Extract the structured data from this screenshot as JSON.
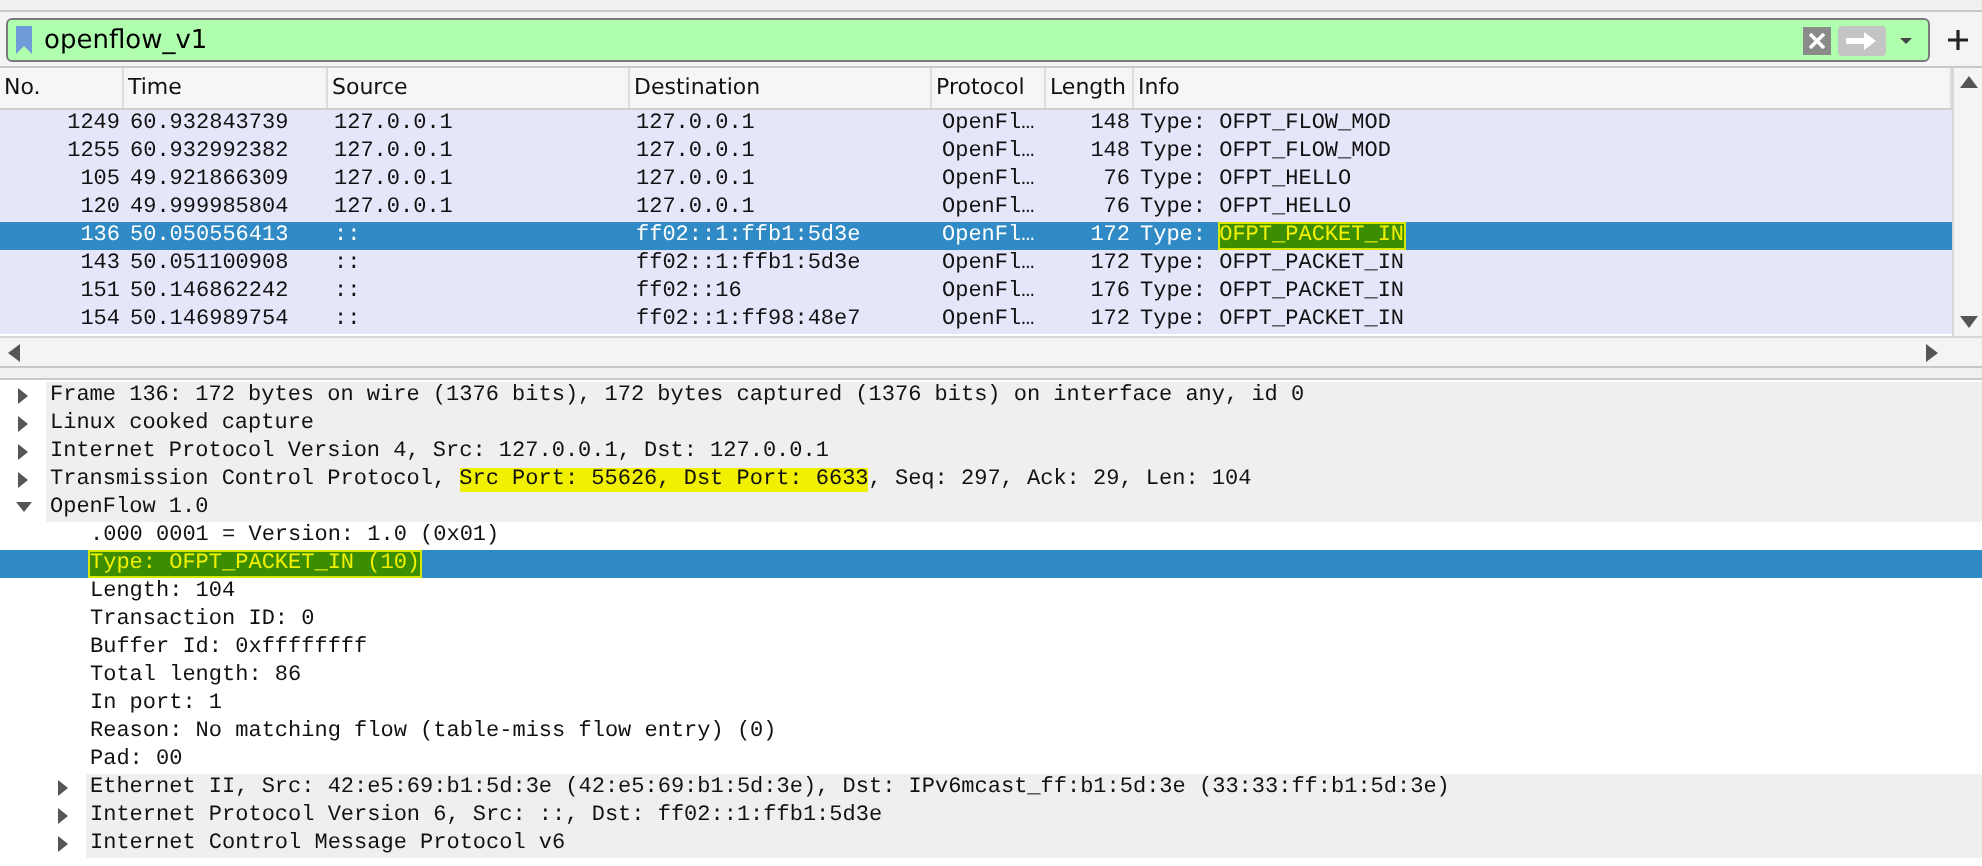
{
  "filter": {
    "value": "openflow_v1"
  },
  "packet_list": {
    "columns": [
      "No.",
      "Time",
      "Source",
      "Destination",
      "Protocol",
      "Length",
      "Info"
    ],
    "rows": [
      {
        "no": "1249",
        "time": "60.932843739",
        "source": "127.0.0.1",
        "destination": "127.0.0.1",
        "protocol": "OpenFl…",
        "length": "148",
        "info": [
          {
            "text": "Type: ",
            "highlighted": false
          },
          {
            "text": "OFPT_FLOW_MOD",
            "highlighted": false
          }
        ],
        "selected": false
      },
      {
        "no": "1255",
        "time": "60.932992382",
        "source": "127.0.0.1",
        "destination": "127.0.0.1",
        "protocol": "OpenFl…",
        "length": "148",
        "info": [
          {
            "text": "Type: ",
            "highlighted": false
          },
          {
            "text": "OFPT_FLOW_MOD",
            "highlighted": false
          }
        ],
        "selected": false
      },
      {
        "no": "105",
        "time": "49.921866309",
        "source": "127.0.0.1",
        "destination": "127.0.0.1",
        "protocol": "OpenFl…",
        "length": "76",
        "info": [
          {
            "text": "Type: ",
            "highlighted": false
          },
          {
            "text": "OFPT_HELLO",
            "highlighted": false
          }
        ],
        "selected": false
      },
      {
        "no": "120",
        "time": "49.999985804",
        "source": "127.0.0.1",
        "destination": "127.0.0.1",
        "protocol": "OpenFl…",
        "length": "76",
        "info": [
          {
            "text": "Type: ",
            "highlighted": false
          },
          {
            "text": "OFPT_HELLO",
            "highlighted": false
          }
        ],
        "selected": false
      },
      {
        "no": "136",
        "time": "50.050556413",
        "source": "::",
        "destination": "ff02::1:ffb1:5d3e",
        "protocol": "OpenFl…",
        "length": "172",
        "info": [
          {
            "text": "Type: ",
            "highlighted": false
          },
          {
            "text": "OFPT_PACKET_IN",
            "highlighted": true
          }
        ],
        "selected": true
      },
      {
        "no": "143",
        "time": "50.051100908",
        "source": "::",
        "destination": "ff02::1:ffb1:5d3e",
        "protocol": "OpenFl…",
        "length": "172",
        "info": [
          {
            "text": "Type: ",
            "highlighted": false
          },
          {
            "text": "OFPT_PACKET_IN",
            "highlighted": false
          }
        ],
        "selected": false
      },
      {
        "no": "151",
        "time": "50.146862242",
        "source": "::",
        "destination": "ff02::16",
        "protocol": "OpenFl…",
        "length": "176",
        "info": [
          {
            "text": "Type: ",
            "highlighted": false
          },
          {
            "text": "OFPT_PACKET_IN",
            "highlighted": false
          }
        ],
        "selected": false
      },
      {
        "no": "154",
        "time": "50.146989754",
        "source": "::",
        "destination": "ff02::1:ff98:48e7",
        "protocol": "OpenFl…",
        "length": "172",
        "info": [
          {
            "text": "Type: ",
            "highlighted": false
          },
          {
            "text": "OFPT_PACKET_IN",
            "highlighted": false
          }
        ],
        "selected": false
      }
    ]
  },
  "details": [
    {
      "segments": [
        {
          "text": "Frame 136: 172 bytes on wire (1376 bits), 172 bytes captured (1376 bits) on interface any, id 0",
          "highlighted": false
        }
      ],
      "expanded": false,
      "selected": false
    },
    {
      "segments": [
        {
          "text": "Linux cooked capture",
          "highlighted": false
        }
      ],
      "expanded": false,
      "selected": false
    },
    {
      "segments": [
        {
          "text": "Internet Protocol Version 4, Src: 127.0.0.1, Dst: 127.0.0.1",
          "highlighted": false
        }
      ],
      "expanded": false,
      "selected": false
    },
    {
      "segments": [
        {
          "text": "Transmission Control Protocol, ",
          "highlighted": false
        },
        {
          "text": "Src Port: 55626, Dst Port: 6633",
          "highlighted": true
        },
        {
          "text": ", Seq: 297, Ack: 29, Len: 104",
          "highlighted": false
        }
      ],
      "expanded": false,
      "selected": false
    },
    {
      "segments": [
        {
          "text": "OpenFlow 1.0",
          "highlighted": false
        }
      ],
      "expanded": true,
      "selected": false,
      "children": [
        {
          "segments": [
            {
              "text": ".000 0001 = Version: 1.0 (0x01)",
              "highlighted": false
            }
          ],
          "selected": false
        },
        {
          "segments": [
            {
              "text": "Type: OFPT_PACKET_IN (10)",
              "highlighted": true
            }
          ],
          "selected": true
        },
        {
          "segments": [
            {
              "text": "Length: 104",
              "highlighted": false
            }
          ],
          "selected": false
        },
        {
          "segments": [
            {
              "text": "Transaction ID: 0",
              "highlighted": false
            }
          ],
          "selected": false
        },
        {
          "segments": [
            {
              "text": "Buffer Id: 0xffffffff",
              "highlighted": false
            }
          ],
          "selected": false
        },
        {
          "segments": [
            {
              "text": "Total length: 86",
              "highlighted": false
            }
          ],
          "selected": false
        },
        {
          "segments": [
            {
              "text": "In port: 1",
              "highlighted": false
            }
          ],
          "selected": false
        },
        {
          "segments": [
            {
              "text": "Reason: No matching flow (table-miss flow entry) (0)",
              "highlighted": false
            }
          ],
          "selected": false
        },
        {
          "segments": [
            {
              "text": "Pad: 00",
              "highlighted": false
            }
          ],
          "selected": false
        },
        {
          "segments": [
            {
              "text": "Ethernet II, Src: 42:e5:69:b1:5d:3e (42:e5:69:b1:5d:3e), Dst: IPv6mcast_ff:b1:5d:3e (33:33:ff:b1:5d:3e)",
              "highlighted": false
            }
          ],
          "expanded": false,
          "selected": false
        },
        {
          "segments": [
            {
              "text": "Internet Protocol Version 6, Src: ::, Dst: ff02::1:ffb1:5d3e",
              "highlighted": false
            }
          ],
          "expanded": false,
          "selected": false
        },
        {
          "segments": [
            {
              "text": "Internet Control Message Protocol v6",
              "highlighted": false
            }
          ],
          "expanded": false,
          "selected": false
        }
      ]
    }
  ]
}
